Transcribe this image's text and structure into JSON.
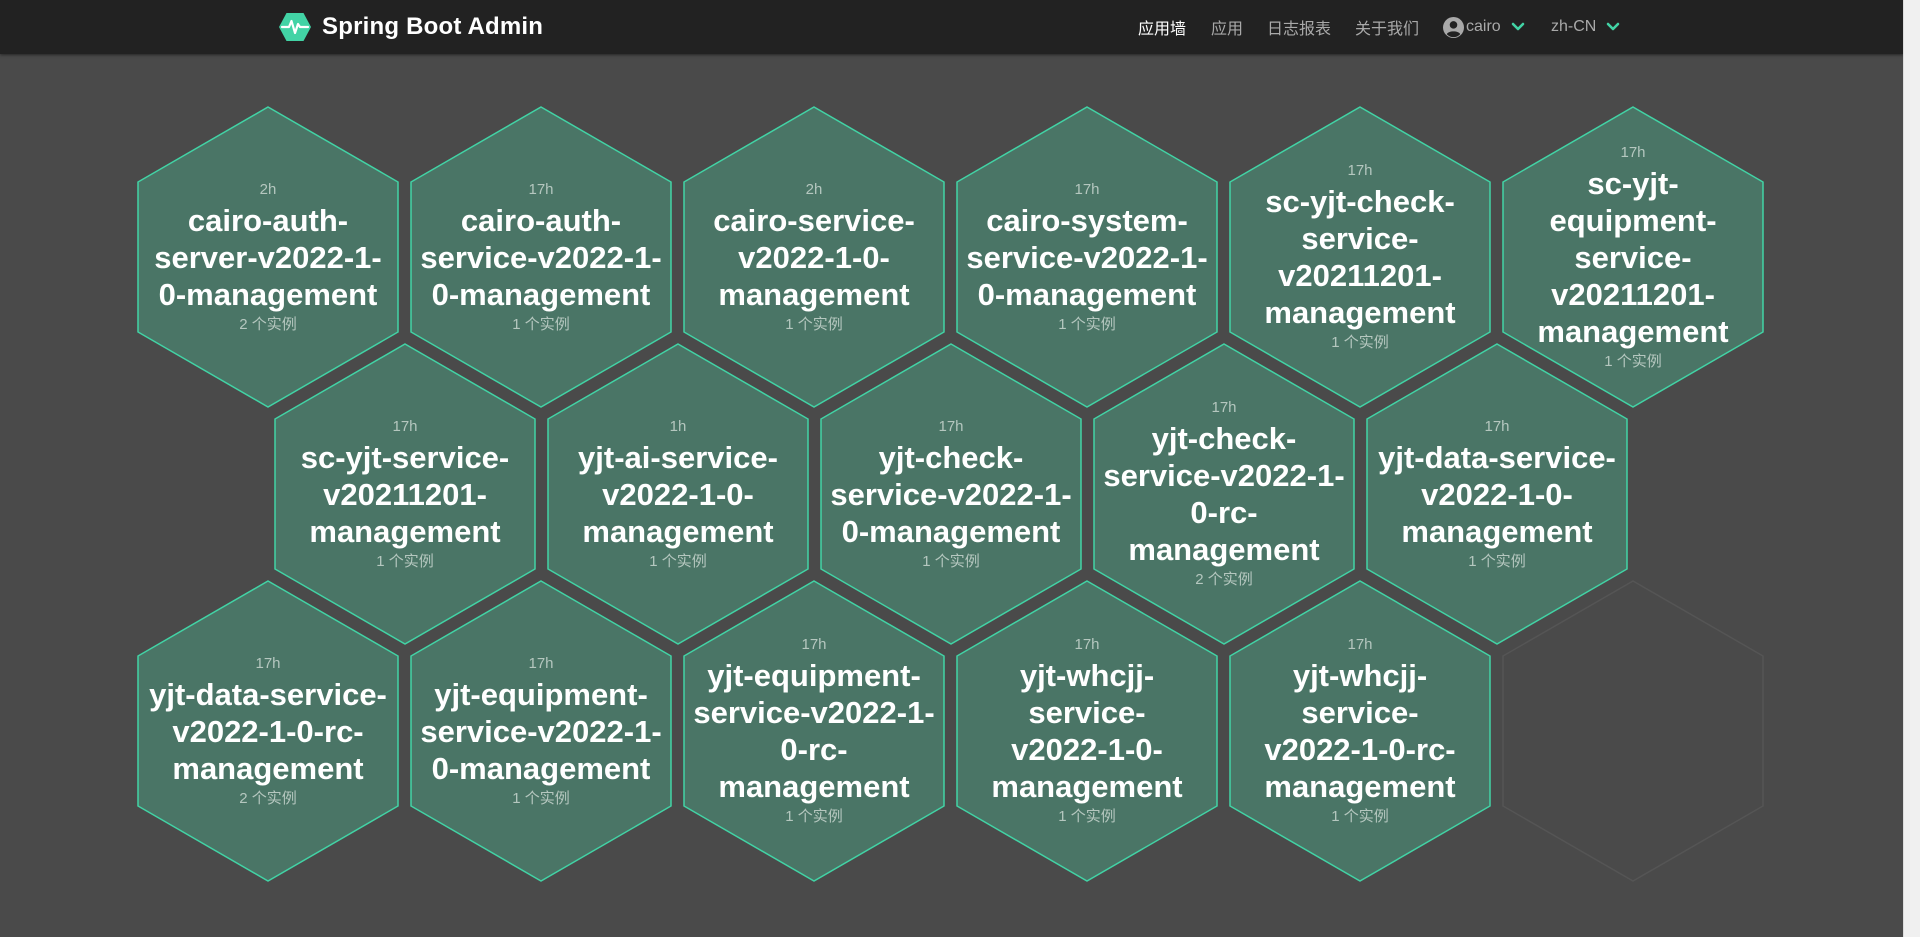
{
  "header": {
    "brand": "Spring Boot Admin",
    "nav": [
      {
        "label": "应用墙",
        "active": true
      },
      {
        "label": "应用",
        "active": false
      },
      {
        "label": "日志报表",
        "active": false
      },
      {
        "label": "关于我们",
        "active": false
      }
    ],
    "user": "cairo",
    "language": "zh-CN"
  },
  "colors": {
    "accent": "#42d3a5",
    "hex_fill": "#4a7566",
    "hex_stroke": "#42d3a5",
    "background": "#4a4a4a",
    "topbar": "#222222",
    "empty_hex_stroke": "#555555"
  },
  "applications": [
    {
      "time": "2h",
      "lines": [
        "cairo-auth-",
        "server-v2022-1-",
        "0-management"
      ],
      "count": "2 个实例"
    },
    {
      "time": "17h",
      "lines": [
        "cairo-auth-",
        "service-v2022-1-",
        "0-management"
      ],
      "count": "1 个实例"
    },
    {
      "time": "2h",
      "lines": [
        "cairo-service-",
        "v2022-1-0-",
        "management"
      ],
      "count": "1 个实例"
    },
    {
      "time": "17h",
      "lines": [
        "cairo-system-",
        "service-v2022-1-",
        "0-management"
      ],
      "count": "1 个实例"
    },
    {
      "time": "17h",
      "lines": [
        "sc-yjt-check-",
        "service-",
        "v20211201-",
        "management"
      ],
      "count": "1 个实例"
    },
    {
      "time": "17h",
      "lines": [
        "sc-yjt-",
        "equipment-",
        "service-",
        "v20211201-",
        "management"
      ],
      "count": "1 个实例"
    },
    {
      "time": "17h",
      "lines": [
        "sc-yjt-service-",
        "v20211201-",
        "management"
      ],
      "count": "1 个实例"
    },
    {
      "time": "1h",
      "lines": [
        "yjt-ai-service-",
        "v2022-1-0-",
        "management"
      ],
      "count": "1 个实例"
    },
    {
      "time": "17h",
      "lines": [
        "yjt-check-",
        "service-v2022-1-",
        "0-management"
      ],
      "count": "1 个实例"
    },
    {
      "time": "17h",
      "lines": [
        "yjt-check-",
        "service-v2022-1-",
        "0-rc-",
        "management"
      ],
      "count": "2 个实例"
    },
    {
      "time": "17h",
      "lines": [
        "yjt-data-service-",
        "v2022-1-0-",
        "management"
      ],
      "count": "1 个实例"
    },
    {
      "time": "17h",
      "lines": [
        "yjt-data-service-",
        "v2022-1-0-rc-",
        "management"
      ],
      "count": "2 个实例"
    },
    {
      "time": "17h",
      "lines": [
        "yjt-equipment-",
        "service-v2022-1-",
        "0-management"
      ],
      "count": "1 个实例"
    },
    {
      "time": "17h",
      "lines": [
        "yjt-equipment-",
        "service-v2022-1-",
        "0-rc-",
        "management"
      ],
      "count": "1 个实例"
    },
    {
      "time": "17h",
      "lines": [
        "yjt-whcjj-service-",
        "v2022-1-0-",
        "management"
      ],
      "count": "1 个实例"
    },
    {
      "time": "17h",
      "lines": [
        "yjt-whcjj-service-",
        "v2022-1-0-rc-",
        "management"
      ],
      "count": "1 个实例"
    }
  ]
}
